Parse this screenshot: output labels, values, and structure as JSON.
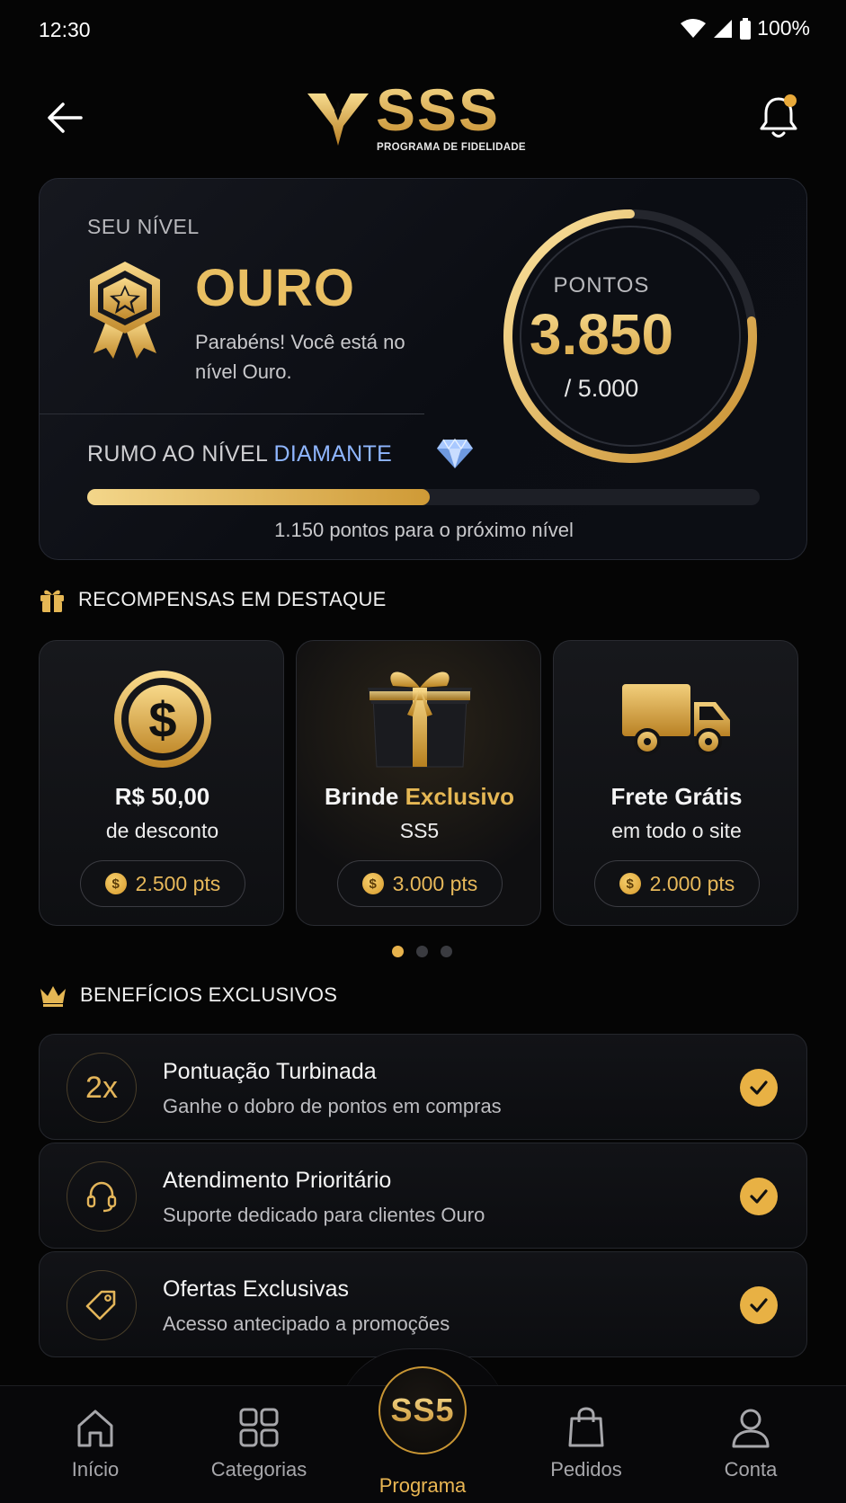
{
  "status_bar": {
    "time": "12:30",
    "battery": "100%"
  },
  "header": {
    "logo_text": "SSS",
    "logo_subtitle": "PROGRAMA DE FIDELIDADE",
    "back_icon": "arrow-left-icon",
    "bell_icon": "bell-icon"
  },
  "level_card": {
    "caption": "SEU NÍVEL",
    "level_name": "OURO",
    "level_desc": "Parabéns! Você está no nível Ouro.",
    "points_label": "PONTOS",
    "points_value": "3.850",
    "points_total": "/ 5.000",
    "points_fraction": 0.77,
    "next_level_prefix": "RUMO AO NÍVEL",
    "next_level_name": "DIAMANTE",
    "progress_fraction": 0.51,
    "progress_note": "1.150 pontos para o próximo nível"
  },
  "rewards_section": {
    "title": "RECOMPENSAS EM DESTAQUE",
    "items": [
      {
        "title": "R$ 50,00",
        "subtitle": "de desconto",
        "points": "2.500 pts",
        "icon": "dollar-coin-icon"
      },
      {
        "title_prefix": "Brinde ",
        "title_highlight": "Exclusivo",
        "subtitle": "SS5",
        "points": "3.000 pts",
        "icon": "gift-box-icon"
      },
      {
        "title": "Frete Grátis",
        "subtitle": "em todo o site",
        "points": "2.000 pts",
        "icon": "delivery-truck-icon"
      }
    ],
    "carousel_pages": 3,
    "carousel_active": 0
  },
  "benefits_section": {
    "title": "BENEFÍCIOS EXCLUSIVOS",
    "items": [
      {
        "icon_text": "2x",
        "title": "Pontuação Turbinada",
        "desc": "Ganhe o dobro de pontos em compras"
      },
      {
        "icon": "headset-icon",
        "title": "Atendimento Prioritário",
        "desc": "Suporte dedicado para clientes Ouro"
      },
      {
        "icon": "tag-icon",
        "title": "Ofertas Exclusivas",
        "desc": "Acesso antecipado a promoções"
      }
    ]
  },
  "bottom_nav": {
    "items": [
      {
        "label": "Início",
        "icon": "home-icon"
      },
      {
        "label": "Categorias",
        "icon": "grid-icon"
      },
      {
        "label": "Programa",
        "icon": "sss-logo-icon",
        "active": true
      },
      {
        "label": "Pedidos",
        "icon": "shopping-bag-icon"
      },
      {
        "label": "Conta",
        "icon": "user-icon"
      }
    ],
    "center_text": "SS5"
  },
  "colors": {
    "accent": "#e5b754",
    "background": "#050505",
    "diamond": "#8fb6ff"
  }
}
